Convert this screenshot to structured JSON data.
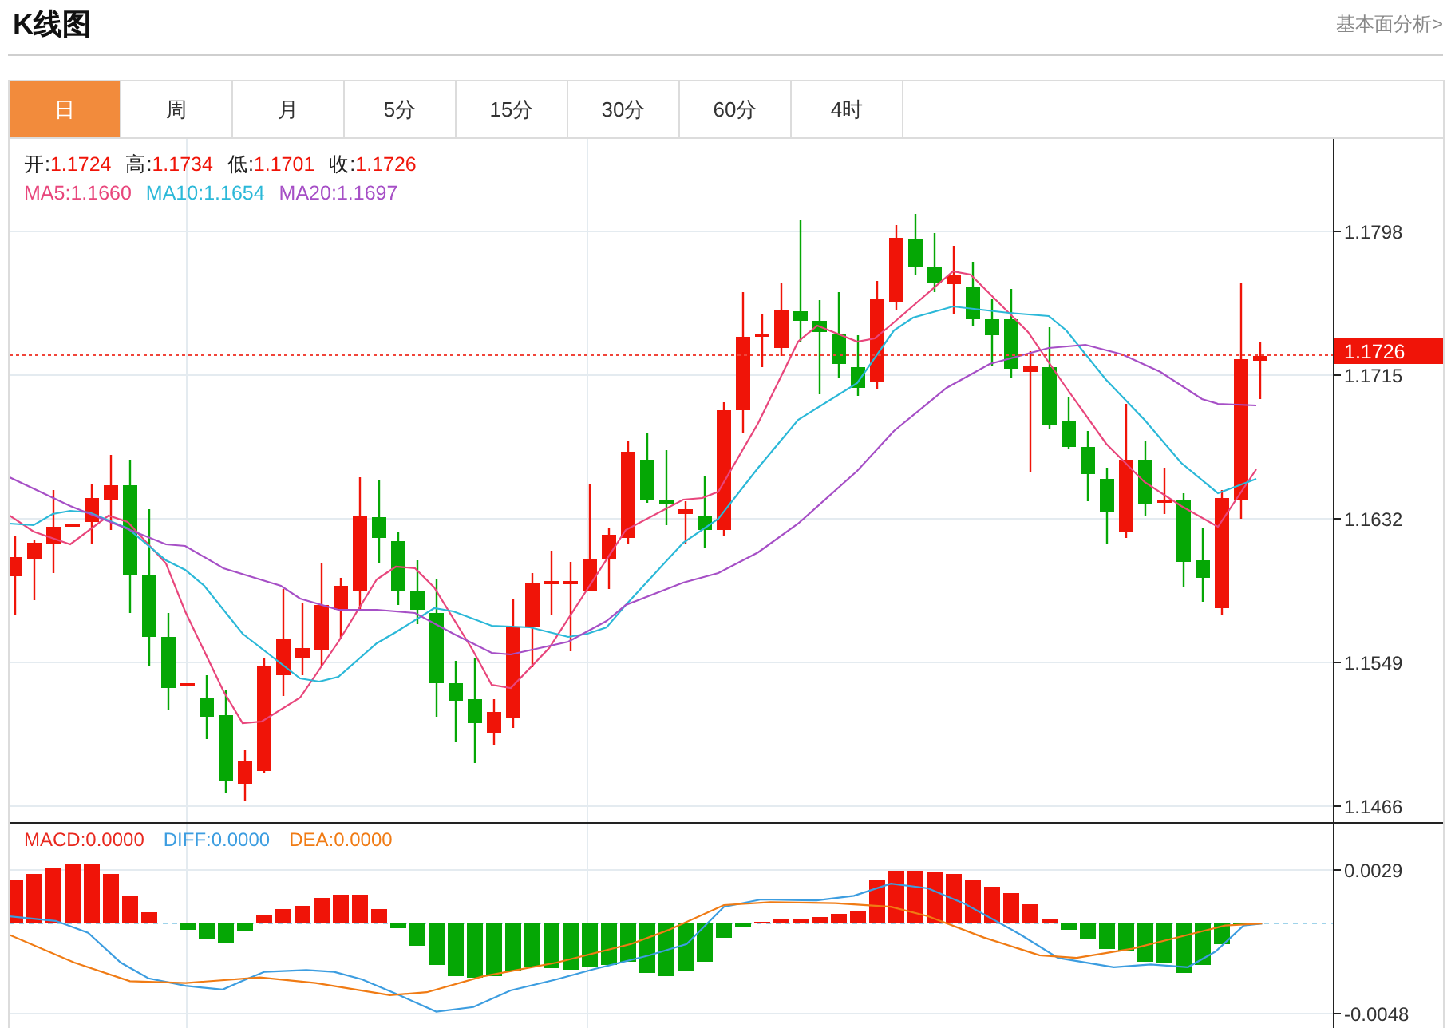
{
  "header": {
    "title": "K线图",
    "link": "基本面分析>"
  },
  "tabs": [
    {
      "label": "日",
      "selected": true
    },
    {
      "label": "周",
      "selected": false
    },
    {
      "label": "月",
      "selected": false
    },
    {
      "label": "5分",
      "selected": false
    },
    {
      "label": "15分",
      "selected": false
    },
    {
      "label": "30分",
      "selected": false
    },
    {
      "label": "60分",
      "selected": false
    },
    {
      "label": "4时",
      "selected": false
    }
  ],
  "ohlc_legend": [
    {
      "label": "开:",
      "value": "1.1724"
    },
    {
      "label": "高:",
      "value": "1.1734"
    },
    {
      "label": "低:",
      "value": "1.1701"
    },
    {
      "label": "收:",
      "value": "1.1726"
    }
  ],
  "ma_legend": [
    {
      "label": "MA5:",
      "value": "1.1660",
      "color": "#e8467c"
    },
    {
      "label": "MA10:",
      "value": "1.1654",
      "color": "#2bb8d8"
    },
    {
      "label": "MA20:",
      "value": "1.1697",
      "color": "#a64fc6"
    }
  ],
  "price_axis": {
    "ticks": [
      "1.1798",
      "1.1715",
      "1.1632",
      "1.1549",
      "1.1466"
    ],
    "current_price": "1.1726"
  },
  "macd_legend": [
    {
      "label": "MACD:",
      "value": "0.0000",
      "color": "#e8281e"
    },
    {
      "label": "DIFF:",
      "value": "0.0000",
      "color": "#3c9de0"
    },
    {
      "label": "DEA:",
      "value": "0.0000",
      "color": "#f07b14"
    }
  ],
  "macd_axis": {
    "ticks": [
      "0.0029",
      "-0.0048"
    ]
  }
}
